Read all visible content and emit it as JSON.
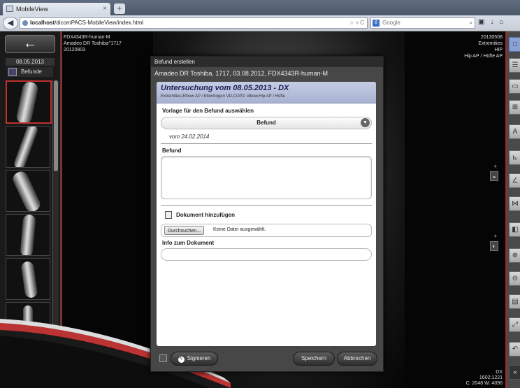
{
  "browser": {
    "tab_title": "MobileView",
    "url_host": "localhost",
    "url_path": "/dicomPACS-MobileView/index.html",
    "search_placeholder": "Google",
    "search_engine_icon": "8"
  },
  "sidebar": {
    "back_icon": "←",
    "study_date": "08.05.2013",
    "befunde_label": "Befunde"
  },
  "viewer": {
    "top_left": [
      "FDX4343R-human-M",
      "Amadeo DR Toshiba^1717",
      "20120803"
    ],
    "top_right": [
      "20130508",
      "Extremities",
      "HIP",
      "Hip AP / Hüfte AP"
    ],
    "bottom_right": [
      "DX",
      "1602:1221",
      "C: 2048 W: 4096"
    ]
  },
  "modal": {
    "header": "Befund erstellen",
    "subheader": "Amadeo DR Toshiba, 1717, 03.08.2012, FDX4343R-human-M",
    "card_title": "Untersuchung vom 08.05.2013 - DX",
    "card_subtitle": "Extremities,Elbow AP / Ellenbogen VD,COP2: elbow,Hip AP / Hüfte",
    "template_label": "Vorlage für den Befund auswählen",
    "template_value": "Befund",
    "template_date": "vom 24.02.2014",
    "befund_label": "Befund",
    "add_doc_label": "Dokument hinzufügen",
    "browse_button": "Durchsuchen...",
    "no_file_text": "Keine Datei ausgewählt.",
    "doc_info_label": "Info zum Dokument",
    "sign_button": "Signieren",
    "save_button": "Speichern",
    "cancel_button": "Abbrechen"
  },
  "colors": {
    "accent_red": "#a02626",
    "card_header": "#b3bcdb",
    "active_tool": "#8aa1d8"
  }
}
